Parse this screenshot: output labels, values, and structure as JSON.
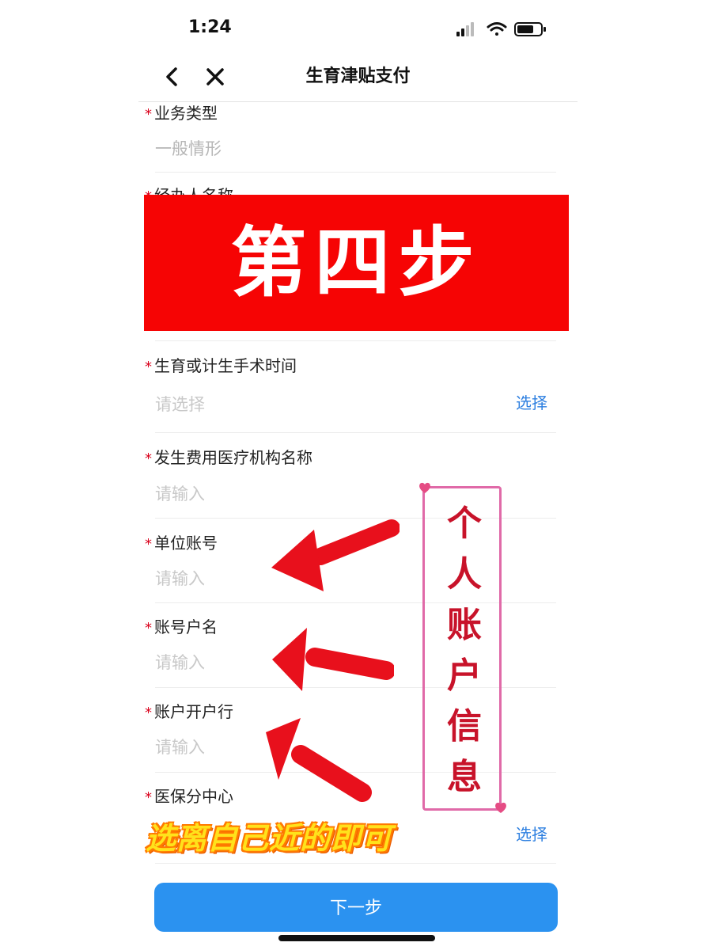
{
  "status_bar": {
    "time": "1:24"
  },
  "nav": {
    "title": "生育津贴支付",
    "back_icon": "chevron-left-icon",
    "close_icon": "close-icon"
  },
  "fields": [
    {
      "label": "业务类型",
      "value": "一般情形",
      "required": true
    },
    {
      "label": "经办人名称",
      "required": true
    },
    {
      "label": "生育或计生手术时间",
      "placeholder": "请选择",
      "action": "选择",
      "required": true
    },
    {
      "label": "发生费用医疗机构名称",
      "placeholder": "请输入",
      "required": true
    },
    {
      "label": "单位账号",
      "placeholder": "请输入",
      "required": true
    },
    {
      "label": "账号户名",
      "placeholder": "请输入",
      "required": true
    },
    {
      "label": "账户开户行",
      "placeholder": "请输入",
      "required": true
    },
    {
      "label": "医保分中心",
      "action": "选择",
      "required": true
    }
  ],
  "required_marker": "*",
  "overlays": {
    "banner_text": "第四步",
    "note_chars": [
      "个",
      "人",
      "账",
      "户",
      "信",
      "息"
    ],
    "hint_text": "选离自己近的即可"
  },
  "next_button": {
    "label": "下一步"
  },
  "colors": {
    "accent": "#2b92f0",
    "link": "#2d7fe0",
    "banner": "#f60404",
    "required": "#d9001b",
    "arrow": "#e8101c"
  }
}
